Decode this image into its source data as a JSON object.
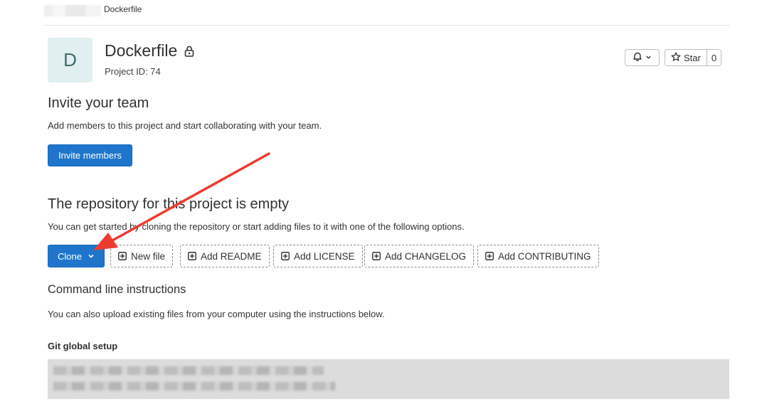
{
  "breadcrumb": {
    "current": "Dockerfile"
  },
  "project": {
    "avatar_letter": "D",
    "name": "Dockerfile",
    "id_text": "Project ID: 74"
  },
  "actions": {
    "star_label": "Star",
    "star_count": "0"
  },
  "invite": {
    "heading": "Invite your team",
    "description": "Add members to this project and start collaborating with your team.",
    "button_label": "Invite members"
  },
  "empty_repo": {
    "heading": "The repository for this project is empty",
    "description": "You can get started by cloning the repository or start adding files to it with one of the following options.",
    "clone_label": "Clone",
    "buttons": [
      "New file",
      "Add README",
      "Add LICENSE",
      "Add CHANGELOG",
      "Add CONTRIBUTING"
    ]
  },
  "cli": {
    "heading": "Command line instructions",
    "description": "You can also upload existing files from your computer using the instructions below.",
    "git_global_setup": "Git global setup"
  },
  "colors": {
    "primary": "#1f75cb",
    "annotation_arrow": "#ee3b2f",
    "avatar_bg": "#e0efef"
  },
  "icons": {
    "lock": "lock-icon",
    "bell": "bell-icon",
    "star": "star-icon",
    "chevron": "chevron-down-icon",
    "plus_square": "plus-square-icon"
  }
}
